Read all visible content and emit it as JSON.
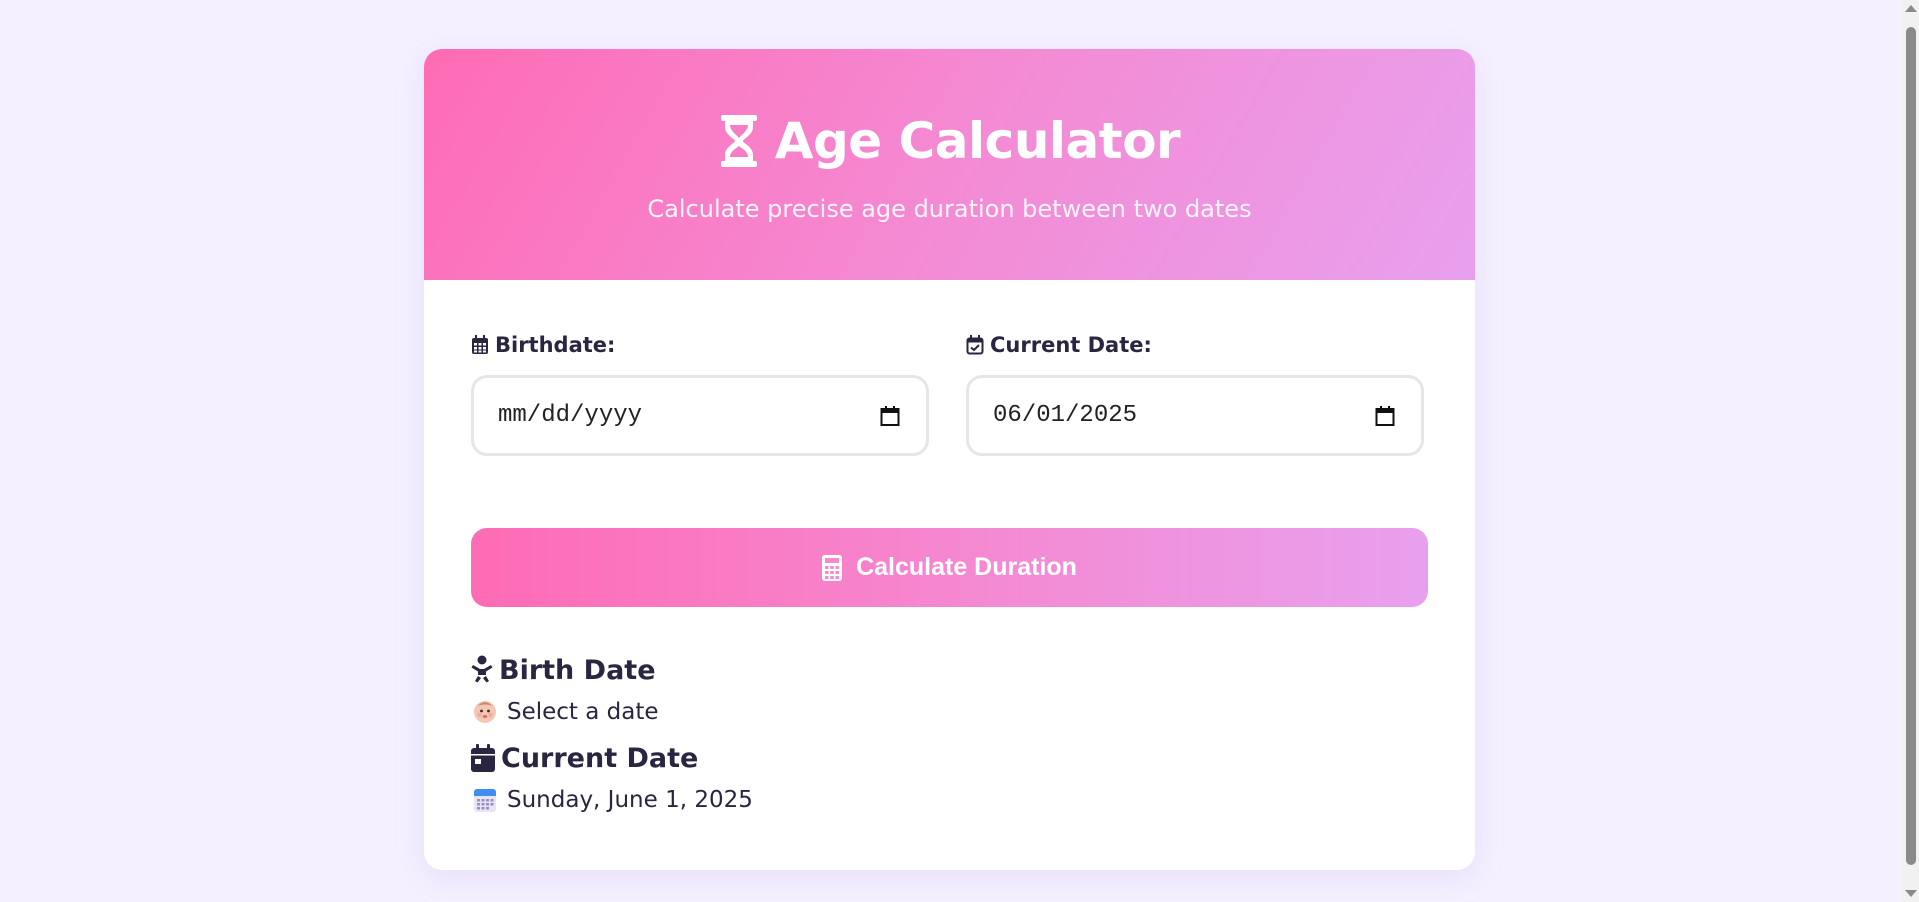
{
  "header": {
    "title": "Age Calculator",
    "subtitle": "Calculate precise age duration between two dates",
    "icon": "hourglass-icon"
  },
  "form": {
    "birthdate": {
      "label": "Birthdate:",
      "value": "mm/dd/yyyy",
      "icon": "calendar-grid-icon"
    },
    "current_date": {
      "label": "Current Date:",
      "value": "06/01/2025",
      "icon": "calendar-check-icon"
    },
    "calculate_button": {
      "label": "Calculate Duration",
      "icon": "calculator-icon"
    }
  },
  "results": {
    "birth_date": {
      "heading": "Birth Date",
      "value": "Select a date",
      "heading_icon": "baby-icon",
      "value_icon": "baby-face-emoji"
    },
    "current_date": {
      "heading": "Current Date",
      "value": "Sunday, June 1, 2025",
      "heading_icon": "calendar-day-icon",
      "value_icon": "calendar-emoji"
    }
  },
  "colors": {
    "background": "#f4f0ff",
    "gradient_start": "#ff6bb5",
    "gradient_end": "#e8a0ee",
    "text": "#2a2540"
  }
}
